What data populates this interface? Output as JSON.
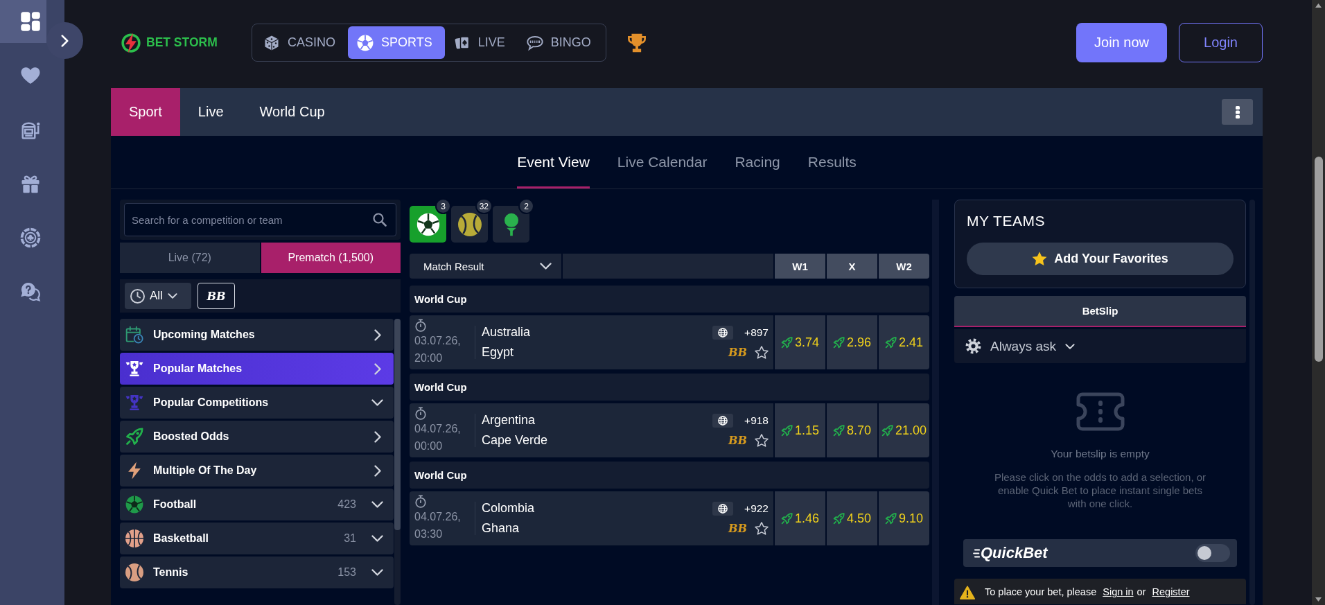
{
  "sidebar": {
    "items": [
      {
        "kind": "dashboard",
        "selected": true
      },
      {
        "kind": "heart",
        "selected": false
      },
      {
        "kind": "slots",
        "selected": false
      },
      {
        "kind": "gift",
        "selected": false
      },
      {
        "kind": "chip",
        "selected": false
      },
      {
        "kind": "help",
        "selected": false
      }
    ]
  },
  "header": {
    "logo": "BET STORM",
    "nav": [
      {
        "kind": "casino",
        "label": "CASINO",
        "selected": false
      },
      {
        "kind": "sports",
        "label": "SPORTS",
        "selected": true
      },
      {
        "kind": "live",
        "label": "LIVE",
        "selected": false
      },
      {
        "kind": "bingo",
        "label": "BINGO",
        "selected": false
      }
    ],
    "buttons": [
      {
        "kind": "primary",
        "label": "Join now"
      },
      {
        "kind": "outline",
        "label": "Login"
      }
    ]
  },
  "section_tabs": [
    {
      "label": "Sport",
      "selected": true
    },
    {
      "label": "Live",
      "selected": false
    },
    {
      "label": "World Cup",
      "selected": false
    }
  ],
  "view_tabs": [
    {
      "label": "Event View",
      "selected": true
    },
    {
      "label": "Live Calendar",
      "selected": false
    },
    {
      "label": "Racing",
      "selected": false
    },
    {
      "label": "Results",
      "selected": false
    }
  ],
  "sports_menu": {
    "search": {
      "placeholder": "Search for a competition or team"
    },
    "mode_tabs": [
      {
        "label": "Live (72)",
        "selected": false
      },
      {
        "label": "Prematch (1,500)",
        "selected": true
      }
    ],
    "time_filter": "All",
    "bet_builder_filter": "BB",
    "items": [
      {
        "kind": "upcoming",
        "label": "Upcoming Matches",
        "expandable": false,
        "selected": false
      },
      {
        "kind": "popular",
        "label": "Popular Matches",
        "expandable": false,
        "selected": true
      },
      {
        "kind": "competitions",
        "label": "Popular Competitions",
        "expandable": true,
        "selected": false
      },
      {
        "kind": "boosted",
        "label": "Boosted Odds",
        "expandable": false,
        "selected": false
      },
      {
        "kind": "multiple",
        "label": "Multiple Of The Day",
        "expandable": false,
        "selected": false
      },
      {
        "kind": "football",
        "label": "Football",
        "count": "423",
        "expandable": true,
        "selected": false
      },
      {
        "kind": "basketball",
        "label": "Basketball",
        "count": "31",
        "expandable": true,
        "selected": false
      },
      {
        "kind": "tennis",
        "label": "Tennis",
        "count": "153",
        "expandable": true,
        "selected": false
      }
    ]
  },
  "events": {
    "sports": [
      {
        "kind": "football",
        "count": "3",
        "selected": true
      },
      {
        "kind": "tennis",
        "count": "32",
        "selected": false
      },
      {
        "kind": "golf",
        "count": "2",
        "selected": false
      }
    ],
    "market": "Match Result",
    "columns": [
      "W1",
      "X",
      "W2"
    ],
    "groups": [
      {
        "competition": "World Cup",
        "start": "03.07.26, 20:00",
        "home": "Australia",
        "away": "Egypt",
        "markets": "+897",
        "bet_builder": "BB",
        "favorite": false,
        "odds": [
          {
            "value": "3.74",
            "boosted": true
          },
          {
            "value": "2.96",
            "boosted": true
          },
          {
            "value": "2.41",
            "boosted": true
          }
        ]
      },
      {
        "competition": "World Cup",
        "start": "04.07.26, 00:00",
        "home": "Argentina",
        "away": "Cape Verde",
        "markets": "+918",
        "bet_builder": "BB",
        "favorite": false,
        "odds": [
          {
            "value": "1.15",
            "boosted": true
          },
          {
            "value": "8.70",
            "boosted": true
          },
          {
            "value": "21.00",
            "boosted": true
          }
        ]
      },
      {
        "competition": "World Cup",
        "start": "04.07.26, 03:30",
        "home": "Colombia",
        "away": "Ghana",
        "markets": "+922",
        "bet_builder": "BB",
        "favorite": false,
        "odds": [
          {
            "value": "1.46",
            "boosted": true
          },
          {
            "value": "4.50",
            "boosted": true
          },
          {
            "value": "9.10",
            "boosted": true
          }
        ]
      }
    ]
  },
  "my_teams": {
    "title": "MY TEAMS",
    "button": "Add Your Favorites"
  },
  "betslip": {
    "tab": "BetSlip",
    "setting": "Always ask",
    "empty_title": "Your betslip is empty",
    "empty_text": "Please click on the odds to add a selection, or enable Quick Bet to place instant single bets with one click.",
    "quick_bet": {
      "label": "QuickBet",
      "on": false
    },
    "notice": [
      {
        "kind": "text",
        "text": "To place your bet, please"
      },
      {
        "kind": "link",
        "text": "Sign in"
      },
      {
        "kind": "text",
        "text": "or"
      },
      {
        "kind": "link",
        "text": "Register"
      }
    ]
  }
}
